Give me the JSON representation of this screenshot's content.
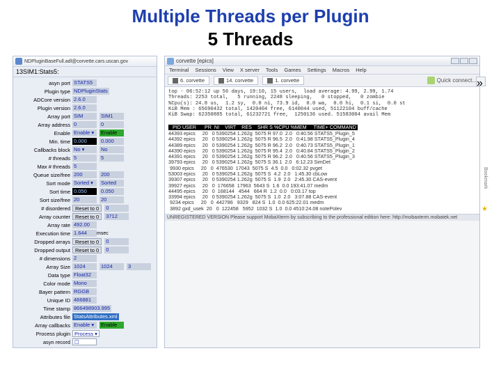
{
  "title": {
    "line1": "Multiple Threads per Plugin",
    "line2": "5 Threads"
  },
  "epics": {
    "window_title": "NDPluginBaseFull.adl@corvette.cars.uscan.gov",
    "address": "13SIM1:Stats5:",
    "rows": [
      {
        "label": "asyn port",
        "v1": "STATS5"
      },
      {
        "label": "Plugin type",
        "v1": "NDPluginStats"
      },
      {
        "label": "ADCore version",
        "v1": "2.6.0"
      },
      {
        "label": "Plugin version",
        "v1": "2.6.0"
      },
      {
        "label": "Array port",
        "v1": "SIM",
        "v2": "SIM1"
      },
      {
        "label": "Array address",
        "v1": "0",
        "v2": "0"
      },
      {
        "label": "Enable",
        "v1": "Enable ▾",
        "v2": "Enable",
        "green": true
      },
      {
        "label": "Min. time",
        "v1": "0.000",
        "v2": "0.000",
        "dark": true
      },
      {
        "label": "Callbacks block",
        "v1": "No ▾",
        "v2": "No"
      },
      {
        "label": "# threads",
        "v1": "5",
        "v2": "5"
      },
      {
        "label": "Max # threads",
        "v1": "5"
      },
      {
        "label": "Queue size/free",
        "v1": "200",
        "v2": "200"
      },
      {
        "label": "Sort mode",
        "v1": "Sorted ▾",
        "v2": "Sorted"
      },
      {
        "label": "Sort time",
        "v1": "0.050",
        "v2": "0.050",
        "dark": true
      },
      {
        "label": "Sort size/free",
        "v1": "20",
        "v2": "20"
      },
      {
        "label": "# disordered",
        "v1": "Reset to 0",
        "v2": "0",
        "btn": true
      },
      {
        "label": "Array counter",
        "v1": "Reset to 0",
        "v2": "3712",
        "btn": true
      },
      {
        "label": "Array rate",
        "v1": "492.00"
      },
      {
        "label": "Execution time",
        "v1": "1.644",
        "unit": "msec"
      },
      {
        "label": "Dropped arrays",
        "v1": "Reset to 0",
        "v2": "0",
        "btn": true
      },
      {
        "label": "Dropped output",
        "v1": "Reset to 0",
        "v2": "0",
        "btn": true
      },
      {
        "label": "# dimensions",
        "v1": "2"
      },
      {
        "label": "Array Size",
        "v1": "1024",
        "v2": "1024",
        "v3": "3"
      },
      {
        "label": "Data type",
        "v1": "Float32"
      },
      {
        "label": "Color mode",
        "v1": "Mono"
      },
      {
        "label": "Bayer pattern",
        "v1": "RGGB"
      },
      {
        "label": "Unique ID",
        "v1": "466881"
      },
      {
        "label": "Time stamp",
        "v1": "866498903.995"
      },
      {
        "label": "Attributes file",
        "v1": "StatsAttributes.xml",
        "status": true
      },
      {
        "label": "Array callbacks",
        "v1": "Enable ▾",
        "v2": "Enable",
        "green": true
      },
      {
        "label": "Process plugin",
        "v1": "Process ▾",
        "white": true
      },
      {
        "label": "asyn record",
        "v1": "☐",
        "white": true
      }
    ]
  },
  "top": {
    "window_title": "corvette [epics]",
    "menus": [
      "Terminal",
      "Sessions",
      "View",
      "X server",
      "Tools",
      "Games",
      "Settings",
      "Macros",
      "Help"
    ],
    "tabs": [
      "6. corvette",
      "14. corvette",
      "1. corvette"
    ],
    "quick_connect": "Quick connect...",
    "header_lines": [
      "top - 06:52:12 up 56 days, 19:10, 15 users,  load average: 4.99, 2.99, 1.74",
      "Threads: 2253 total,   5 running, 2248 sleeping,   0 stopped,   0 zombie",
      "%Cpu(s): 24.8 us,  1.2 sy,  0.0 ni, 73.9 id,  0.0 wa,  0.0 hi,  0.1 si,  0.0 st",
      "KiB Mem : 65690432 total, 1420404 free, 6140044 used, 51122104 buff/cache",
      "KiB Swap: 62350885 total, 61232721 free,  1250136 used. 51583004 avail Mem"
    ],
    "columns": "  PID USER      PR  NI    VIRT    RES    SHR S %CPU %MEM     TIME+ COMMAND",
    "procs": [
      "44393 epics     20   0 5390254 1.262g  5075 R 97.0  2.0   0:40.56 STATS5_Plugin_5",
      "44392 epics     20   0 5390254 1.262g  5075 R 96.5  2.0   0:41.98 STATS5_Plugin_4",
      "44389 epics     20   0 5390254 1.262g  5075 R 96.2  2.0   0:40.73 STATS5_Plugin_1",
      "44390 epics     20   0 5390254 1.262g  5075 R 95.4  2.0   0:40.84 STATS5_Plugin_2",
      "44391 epics     20   0 5390254 1.262g  5075 R 96.2  2.0   0:40.56 STATS5_Plugin_3",
      "39793 epics     20   0 5390254 1.262g  5075 S 36.1  2.0   6:12.23 SimDet",
      " 9930 epics     20   0  476530  17043  5075 S  4.5  0.0   0:02.32 pvget",
      "53003 epics     20   0 5390254 1.262g  5075 S  4.2  2.0   1:45.30 cbLow",
      "39307 epics     20   0 5390254 1.262g  5075 S  1.9  2.0   2:45.30 CAS-event",
      "39927 epics     20   0  176658  17963  5643 S  1.6  0.0 193:41.07 medm",
      "44495 epics     20   0  168144   4544   664 R  1.2  0.0   0:03.17 top",
      "33994 epics     20   0 5390254 1.262g  5075 S  1.0  2.0   3:07.88 CAS-event",
      " 9234 epics     20   0  442786   9329   824 S  1.0  0.0 625:22.01 medm",
      " 3892 gxd_usek  20   0  122458   5952  1032 S  1.0  0.0 4510:24.08 notePolev"
    ],
    "footer": "UNREGISTERED VERSION   Please support MobaXterm by subscribing to the professional edition here: http://mobaxterm.mobatek.net"
  },
  "bookmark_label": "Bookmark"
}
